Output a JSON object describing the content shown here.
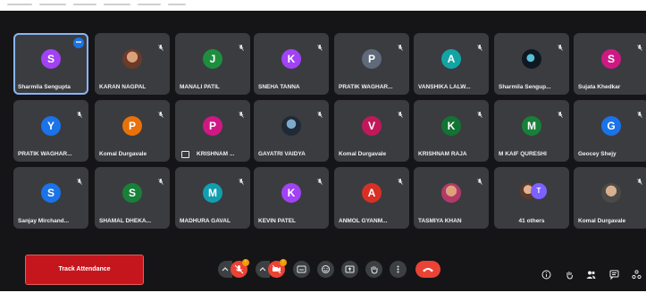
{
  "participants": [
    {
      "name": "Sharmila Sengupta",
      "initial": "S",
      "color": "#a142f4",
      "active": true,
      "kind": "letter"
    },
    {
      "name": "KARAN NAGPAL",
      "initial": "",
      "color": "",
      "kind": "photo"
    },
    {
      "name": "MANALI PATIL",
      "initial": "J",
      "color": "#1e8e3e",
      "kind": "letter"
    },
    {
      "name": "SNEHA TANNA",
      "initial": "K",
      "color": "#a142f4",
      "kind": "letter"
    },
    {
      "name": "PRATIK WAGHAR...",
      "initial": "P",
      "color": "#5f6a7a",
      "kind": "letter"
    },
    {
      "name": "VANSHIKA LALW...",
      "initial": "A",
      "color": "#12a4a4",
      "kind": "letter"
    },
    {
      "name": "Sharmila Sengup...",
      "initial": "",
      "color": "",
      "kind": "photo3"
    },
    {
      "name": "Sujata Khedkar",
      "initial": "S",
      "color": "#d01884",
      "kind": "letter"
    },
    {
      "name": "PRATIK WAGHAR...",
      "initial": "Y",
      "color": "#1a73e8",
      "kind": "letter"
    },
    {
      "name": "Komal Durgavale",
      "initial": "P",
      "color": "#e8710a",
      "kind": "letter"
    },
    {
      "name": "KRISHNAM ...",
      "initial": "P",
      "color": "#d01884",
      "kind": "letter",
      "presenting": true
    },
    {
      "name": "GAYATRI VAIDYA",
      "initial": "",
      "color": "",
      "kind": "photo2"
    },
    {
      "name": "Komal Durgavale",
      "initial": "V",
      "color": "#c2185b",
      "kind": "letter"
    },
    {
      "name": "KRISHNAM RAJA",
      "initial": "K",
      "color": "#137333",
      "kind": "letter"
    },
    {
      "name": "M KAIF QURESHI",
      "initial": "M",
      "color": "#188038",
      "kind": "letter"
    },
    {
      "name": "Geocey Shejy",
      "initial": "G",
      "color": "#1a73e8",
      "kind": "letter"
    },
    {
      "name": "Sanjay Mirchand...",
      "initial": "S",
      "color": "#1a73e8",
      "kind": "letter"
    },
    {
      "name": "SHAMAL DHEKA...",
      "initial": "S",
      "color": "#188038",
      "kind": "letter"
    },
    {
      "name": "MADHURA GAVAL",
      "initial": "M",
      "color": "#129eaf",
      "kind": "letter"
    },
    {
      "name": "KEVIN PATEL",
      "initial": "K",
      "color": "#a142f4",
      "kind": "letter"
    },
    {
      "name": "ANMOL GYANM...",
      "initial": "A",
      "color": "#d93025",
      "kind": "letter"
    },
    {
      "name": "TASMIYA KHAN",
      "initial": "",
      "color": "",
      "kind": "photo4"
    },
    {
      "name": "41 others",
      "initial": "T",
      "color": "#7b61ff",
      "kind": "others"
    },
    {
      "name": "Komal Durgavale",
      "initial": "",
      "color": "",
      "kind": "photo5"
    }
  ],
  "toolbar": {
    "track_attendance_label": "Track Attendance",
    "mic_badge": "!",
    "cam_badge": "!"
  },
  "colors": {
    "background": "#151517",
    "tile": "#3b3c40",
    "accent": "#8ab4f8",
    "danger": "#ea4335",
    "track_button": "#c5161e"
  }
}
